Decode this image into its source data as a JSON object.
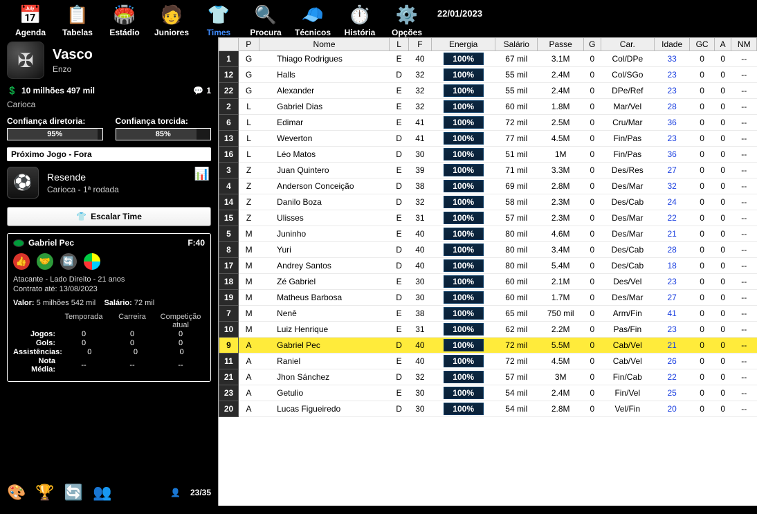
{
  "date": "22/01/2023",
  "nav": {
    "items": [
      {
        "label": "Agenda",
        "glyph": "📅"
      },
      {
        "label": "Tabelas",
        "glyph": "📋"
      },
      {
        "label": "Estádio",
        "glyph": "🏟️"
      },
      {
        "label": "Juniores",
        "glyph": "🧑"
      },
      {
        "label": "Times",
        "glyph": "👕",
        "active": true
      },
      {
        "label": "Procura",
        "glyph": "🔍"
      },
      {
        "label": "Técnicos",
        "glyph": "🧢"
      },
      {
        "label": "História",
        "glyph": "⏱️"
      },
      {
        "label": "Opções",
        "glyph": "⚙️"
      }
    ]
  },
  "club": {
    "name": "Vasco",
    "manager": "Enzo",
    "balance_label": "10 milhões 497 mil",
    "msg_count": "1",
    "league": "Carioca",
    "conf_board_label": "Confiança diretoria:",
    "conf_board_value": "95%",
    "conf_board_pct": 95,
    "conf_fans_label": "Confiança torcida:",
    "conf_fans_value": "85%",
    "conf_fans_pct": 85
  },
  "next_match": {
    "section_label": "Próximo Jogo - Fora",
    "opponent": "Resende",
    "competition": "Carioca - 1ª rodada"
  },
  "escalar_label": "Escalar Time",
  "player_card": {
    "name": "Gabriel Pec",
    "form": "F:40",
    "pos_age": "Atacante - Lado Direito - 21 anos",
    "contract": "Contrato até: 13/08/2023",
    "value_label": "Valor:",
    "value": "5 milhões 542 mil",
    "salary_label": "Salário:",
    "salary": "72 mil",
    "cols": [
      "Temporada",
      "Carreira",
      "Competição atual"
    ],
    "rows": [
      {
        "label": "Jogos:",
        "v": [
          "0",
          "0",
          "0"
        ]
      },
      {
        "label": "Gols:",
        "v": [
          "0",
          "0",
          "0"
        ]
      },
      {
        "label": "Assistências:",
        "v": [
          "0",
          "0",
          "0"
        ]
      },
      {
        "label": "Nota Média:",
        "v": [
          "--",
          "--",
          "--"
        ]
      }
    ]
  },
  "squad_count": "23/35",
  "table": {
    "headers": [
      "",
      "P",
      "Nome",
      "L",
      "F",
      "Energia",
      "Salário",
      "Passe",
      "G",
      "Car.",
      "Idade",
      "GC",
      "A",
      "NM"
    ],
    "rows": [
      {
        "num": "1",
        "p": "G",
        "name": "Thiago Rodrigues",
        "l": "E",
        "f": "40",
        "e": "100%",
        "sal": "67 mil",
        "pass": "3.1M",
        "g": "0",
        "car": "Col/DPe",
        "age": "33",
        "gc": "0",
        "a": "0",
        "nm": "--"
      },
      {
        "num": "12",
        "p": "G",
        "name": "Halls",
        "l": "D",
        "f": "32",
        "e": "100%",
        "sal": "55 mil",
        "pass": "2.4M",
        "g": "0",
        "car": "Col/SGo",
        "age": "23",
        "gc": "0",
        "a": "0",
        "nm": "--"
      },
      {
        "num": "22",
        "p": "G",
        "name": "Alexander",
        "l": "E",
        "f": "32",
        "e": "100%",
        "sal": "55 mil",
        "pass": "2.4M",
        "g": "0",
        "car": "DPe/Ref",
        "age": "23",
        "gc": "0",
        "a": "0",
        "nm": "--"
      },
      {
        "num": "2",
        "p": "L",
        "name": "Gabriel Dias",
        "l": "E",
        "f": "32",
        "e": "100%",
        "sal": "60 mil",
        "pass": "1.8M",
        "g": "0",
        "car": "Mar/Vel",
        "age": "28",
        "gc": "0",
        "a": "0",
        "nm": "--"
      },
      {
        "num": "6",
        "p": "L",
        "name": "Edimar",
        "l": "E",
        "f": "41",
        "e": "100%",
        "sal": "72 mil",
        "pass": "2.5M",
        "g": "0",
        "car": "Cru/Mar",
        "age": "36",
        "gc": "0",
        "a": "0",
        "nm": "--"
      },
      {
        "num": "13",
        "p": "L",
        "name": "Weverton",
        "l": "D",
        "f": "41",
        "e": "100%",
        "sal": "77 mil",
        "pass": "4.5M",
        "g": "0",
        "car": "Fin/Pas",
        "age": "23",
        "gc": "0",
        "a": "0",
        "nm": "--"
      },
      {
        "num": "16",
        "p": "L",
        "name": "Léo Matos",
        "l": "D",
        "f": "30",
        "e": "100%",
        "sal": "51 mil",
        "pass": "1M",
        "g": "0",
        "car": "Fin/Pas",
        "age": "36",
        "gc": "0",
        "a": "0",
        "nm": "--"
      },
      {
        "num": "3",
        "p": "Z",
        "name": "Juan Quintero",
        "l": "E",
        "f": "39",
        "e": "100%",
        "sal": "71 mil",
        "pass": "3.3M",
        "g": "0",
        "car": "Des/Res",
        "age": "27",
        "gc": "0",
        "a": "0",
        "nm": "--"
      },
      {
        "num": "4",
        "p": "Z",
        "name": "Anderson Conceição",
        "l": "D",
        "f": "38",
        "e": "100%",
        "sal": "69 mil",
        "pass": "2.8M",
        "g": "0",
        "car": "Des/Mar",
        "age": "32",
        "gc": "0",
        "a": "0",
        "nm": "--"
      },
      {
        "num": "14",
        "p": "Z",
        "name": "Danilo Boza",
        "l": "D",
        "f": "32",
        "e": "100%",
        "sal": "58 mil",
        "pass": "2.3M",
        "g": "0",
        "car": "Des/Cab",
        "age": "24",
        "gc": "0",
        "a": "0",
        "nm": "--"
      },
      {
        "num": "15",
        "p": "Z",
        "name": "Ulisses",
        "l": "E",
        "f": "31",
        "e": "100%",
        "sal": "57 mil",
        "pass": "2.3M",
        "g": "0",
        "car": "Des/Mar",
        "age": "22",
        "gc": "0",
        "a": "0",
        "nm": "--"
      },
      {
        "num": "5",
        "p": "M",
        "name": "Juninho",
        "l": "E",
        "f": "40",
        "e": "100%",
        "sal": "80 mil",
        "pass": "4.6M",
        "g": "0",
        "car": "Des/Mar",
        "age": "21",
        "gc": "0",
        "a": "0",
        "nm": "--"
      },
      {
        "num": "8",
        "p": "M",
        "name": "Yuri",
        "l": "D",
        "f": "40",
        "e": "100%",
        "sal": "80 mil",
        "pass": "3.4M",
        "g": "0",
        "car": "Des/Cab",
        "age": "28",
        "gc": "0",
        "a": "0",
        "nm": "--"
      },
      {
        "num": "17",
        "p": "M",
        "name": "Andrey Santos",
        "l": "D",
        "f": "40",
        "e": "100%",
        "sal": "80 mil",
        "pass": "5.4M",
        "g": "0",
        "car": "Des/Cab",
        "age": "18",
        "gc": "0",
        "a": "0",
        "nm": "--"
      },
      {
        "num": "18",
        "p": "M",
        "name": "Zé Gabriel",
        "l": "E",
        "f": "30",
        "e": "100%",
        "sal": "60 mil",
        "pass": "2.1M",
        "g": "0",
        "car": "Des/Vel",
        "age": "23",
        "gc": "0",
        "a": "0",
        "nm": "--"
      },
      {
        "num": "19",
        "p": "M",
        "name": "Matheus Barbosa",
        "l": "D",
        "f": "30",
        "e": "100%",
        "sal": "60 mil",
        "pass": "1.7M",
        "g": "0",
        "car": "Des/Mar",
        "age": "27",
        "gc": "0",
        "a": "0",
        "nm": "--"
      },
      {
        "num": "7",
        "p": "M",
        "name": "Nenê",
        "l": "E",
        "f": "38",
        "e": "100%",
        "sal": "65 mil",
        "pass": "750 mil",
        "g": "0",
        "car": "Arm/Fin",
        "age": "41",
        "gc": "0",
        "a": "0",
        "nm": "--"
      },
      {
        "num": "10",
        "p": "M",
        "name": "Luiz Henrique",
        "l": "E",
        "f": "31",
        "e": "100%",
        "sal": "62 mil",
        "pass": "2.2M",
        "g": "0",
        "car": "Pas/Fin",
        "age": "23",
        "gc": "0",
        "a": "0",
        "nm": "--"
      },
      {
        "num": "9",
        "p": "A",
        "name": "Gabriel Pec",
        "l": "D",
        "f": "40",
        "e": "100%",
        "sal": "72 mil",
        "pass": "5.5M",
        "g": "0",
        "car": "Cab/Vel",
        "age": "21",
        "gc": "0",
        "a": "0",
        "nm": "--",
        "selected": true
      },
      {
        "num": "11",
        "p": "A",
        "name": "Raniel",
        "l": "E",
        "f": "40",
        "e": "100%",
        "sal": "72 mil",
        "pass": "4.5M",
        "g": "0",
        "car": "Cab/Vel",
        "age": "26",
        "gc": "0",
        "a": "0",
        "nm": "--"
      },
      {
        "num": "21",
        "p": "A",
        "name": "Jhon Sánchez",
        "l": "D",
        "f": "32",
        "e": "100%",
        "sal": "57 mil",
        "pass": "3M",
        "g": "0",
        "car": "Fin/Cab",
        "age": "22",
        "gc": "0",
        "a": "0",
        "nm": "--"
      },
      {
        "num": "23",
        "p": "A",
        "name": "Getulio",
        "l": "E",
        "f": "30",
        "e": "100%",
        "sal": "54 mil",
        "pass": "2.4M",
        "g": "0",
        "car": "Fin/Vel",
        "age": "25",
        "gc": "0",
        "a": "0",
        "nm": "--"
      },
      {
        "num": "20",
        "p": "A",
        "name": "Lucas Figueiredo",
        "l": "D",
        "f": "30",
        "e": "100%",
        "sal": "54 mil",
        "pass": "2.8M",
        "g": "0",
        "car": "Vel/Fin",
        "age": "20",
        "gc": "0",
        "a": "0",
        "nm": "--"
      }
    ]
  }
}
